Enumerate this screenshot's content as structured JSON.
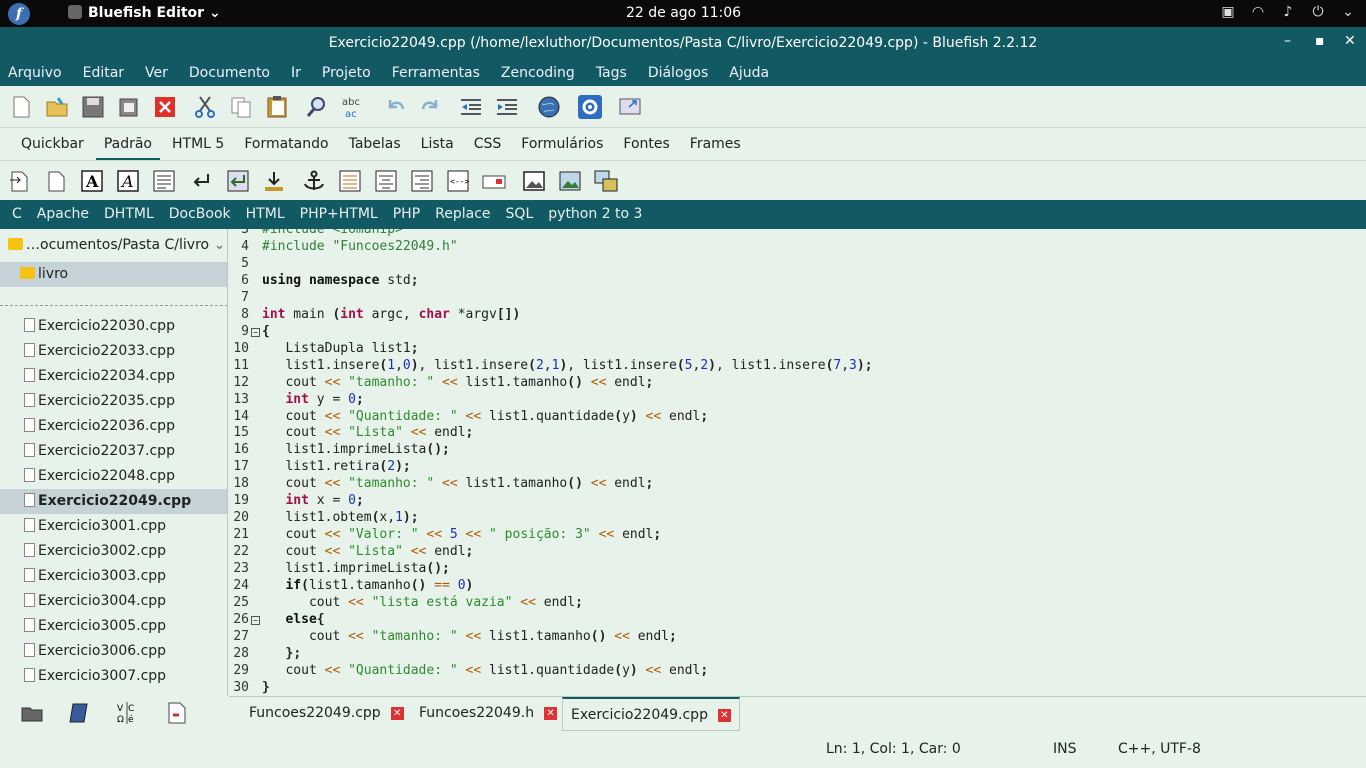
{
  "topbar": {
    "app_name": "Bluefish Editor ⌄",
    "clock": "22 de ago  11:06"
  },
  "window": {
    "title": "Exercicio22049.cpp (/home/lexluthor/Documentos/Pasta C/livro/Exercicio22049.cpp) - Bluefish 2.2.12"
  },
  "menu": [
    "Arquivo",
    "Editar",
    "Ver",
    "Documento",
    "Ir",
    "Projeto",
    "Ferramentas",
    "Zencoding",
    "Tags",
    "Diálogos",
    "Ajuda"
  ],
  "html_tabs": [
    "Quickbar",
    "Padrão",
    "HTML 5",
    "Formatando",
    "Tabelas",
    "Lista",
    "CSS",
    "Formulários",
    "Fontes",
    "Frames"
  ],
  "snippets": [
    "C",
    "Apache",
    "DHTML",
    "DocBook",
    "HTML",
    "PHP+HTML",
    "PHP",
    "Replace",
    "SQL",
    "python 2 to 3"
  ],
  "sidebar": {
    "path": "…ocumentos/Pasta C/livro",
    "dir": "livro",
    "files": [
      "Exercicio22030.cpp",
      "Exercicio22033.cpp",
      "Exercicio22034.cpp",
      "Exercicio22035.cpp",
      "Exercicio22036.cpp",
      "Exercicio22037.cpp",
      "Exercicio22048.cpp",
      "Exercicio22049.cpp",
      "Exercicio3001.cpp",
      "Exercicio3002.cpp",
      "Exercicio3003.cpp",
      "Exercicio3004.cpp",
      "Exercicio3005.cpp",
      "Exercicio3006.cpp",
      "Exercicio3007.cpp"
    ],
    "selected": "Exercicio22049.cpp"
  },
  "editor": {
    "lines": [
      {
        "n": "4",
        "text": "#include \"Funcoes22049.h\""
      },
      {
        "n": "5",
        "text": ""
      },
      {
        "n": "6",
        "text": "using namespace std;"
      },
      {
        "n": "7",
        "text": ""
      },
      {
        "n": "8",
        "text": "int main (int argc, char *argv[])"
      },
      {
        "n": "9",
        "text": "{"
      },
      {
        "n": "10",
        "text": "   ListaDupla list1;"
      },
      {
        "n": "11",
        "text": "   list1.insere(1,0), list1.insere(2,1), list1.insere(5,2), list1.insere(7,3);"
      },
      {
        "n": "12",
        "text": "   cout << \"tamanho: \" << list1.tamanho() << endl;"
      },
      {
        "n": "13",
        "text": "   int y = 0;"
      },
      {
        "n": "14",
        "text": "   cout << \"Quantidade: \" << list1.quantidade(y) << endl;"
      },
      {
        "n": "15",
        "text": "   cout << \"Lista\" << endl;"
      },
      {
        "n": "16",
        "text": "   list1.imprimeLista();"
      },
      {
        "n": "17",
        "text": "   list1.retira(2);"
      },
      {
        "n": "18",
        "text": "   cout << \"tamanho: \" << list1.tamanho() << endl;"
      },
      {
        "n": "19",
        "text": "   int x = 0;"
      },
      {
        "n": "20",
        "text": "   list1.obtem(x,1);"
      },
      {
        "n": "21",
        "text": "   cout << \"Valor: \" << 5 << \" posição: 3\" << endl;"
      },
      {
        "n": "22",
        "text": "   cout << \"Lista\" << endl;"
      },
      {
        "n": "23",
        "text": "   list1.imprimeLista();"
      },
      {
        "n": "24",
        "text": "   if(list1.tamanho() == 0)"
      },
      {
        "n": "25",
        "text": "      cout << \"lista está vazia\" << endl;"
      },
      {
        "n": "26",
        "text": "   else{"
      },
      {
        "n": "27",
        "text": "      cout << \"tamanho: \" << list1.tamanho() << endl;"
      },
      {
        "n": "28",
        "text": "   };"
      },
      {
        "n": "29",
        "text": "   cout << \"Quantidade: \" << list1.quantidade(y) << endl;"
      },
      {
        "n": "30",
        "text": "}"
      }
    ]
  },
  "doc_tabs": [
    "Funcoes22049.cpp",
    "Funcoes22049.h",
    "Exercicio22049.cpp"
  ],
  "status": {
    "position": "Ln: 1, Col: 1, Car: 0",
    "mode": "INS",
    "encoding": "C++, UTF-8"
  }
}
